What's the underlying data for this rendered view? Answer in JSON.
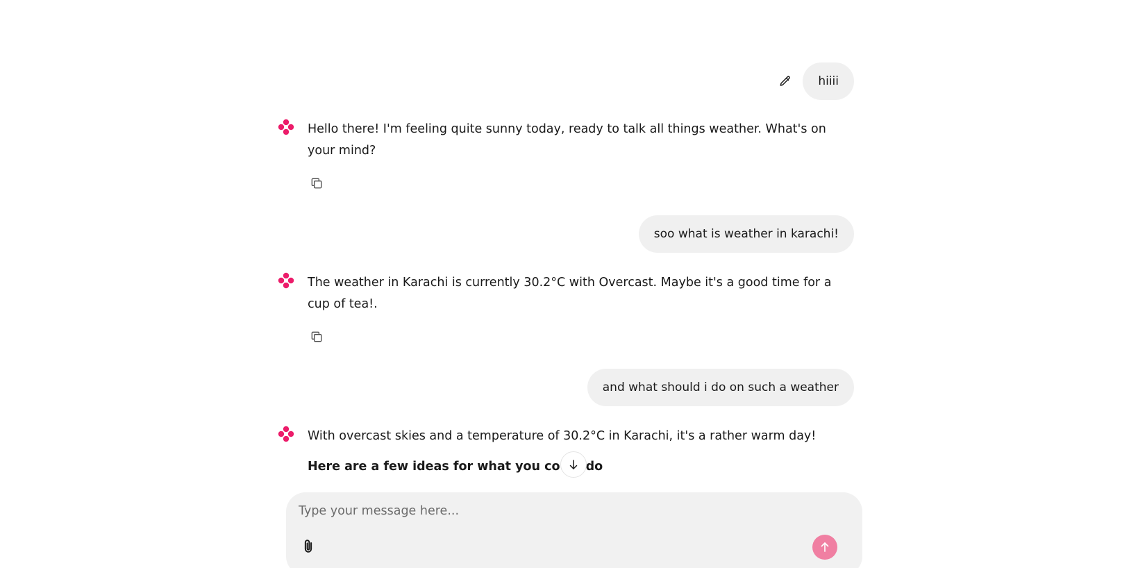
{
  "colors": {
    "accent": "#ec1c6a",
    "send_button": "#f07fa2",
    "bubble_bg": "#f0f0f0",
    "composer_bg": "#f1f1f1"
  },
  "messages": [
    {
      "role": "user",
      "text": "hiiii",
      "has_edit": true
    },
    {
      "role": "assistant",
      "text": "Hello there! I'm feeling quite sunny today, ready to talk all things weather. What's on your mind?"
    },
    {
      "role": "user",
      "text": "soo what is weather in karachi!"
    },
    {
      "role": "assistant",
      "text": "The weather in Karachi is currently 30.2°C with Overcast. Maybe it's a good time for a cup of tea!."
    },
    {
      "role": "user",
      "text": "and what should i do on such a weather"
    },
    {
      "role": "assistant",
      "text": "With overcast skies and a temperature of 30.2°C in Karachi, it's a rather warm day!",
      "heading": "Here are a few ideas for what you could do"
    }
  ],
  "icons": {
    "edit": "pencil-icon",
    "copy": "copy-icon",
    "avatar": "flower-logo-icon",
    "scroll": "arrow-down-icon",
    "attach": "paperclip-icon",
    "send": "arrow-up-icon"
  },
  "composer": {
    "placeholder": "Type your message here..."
  }
}
